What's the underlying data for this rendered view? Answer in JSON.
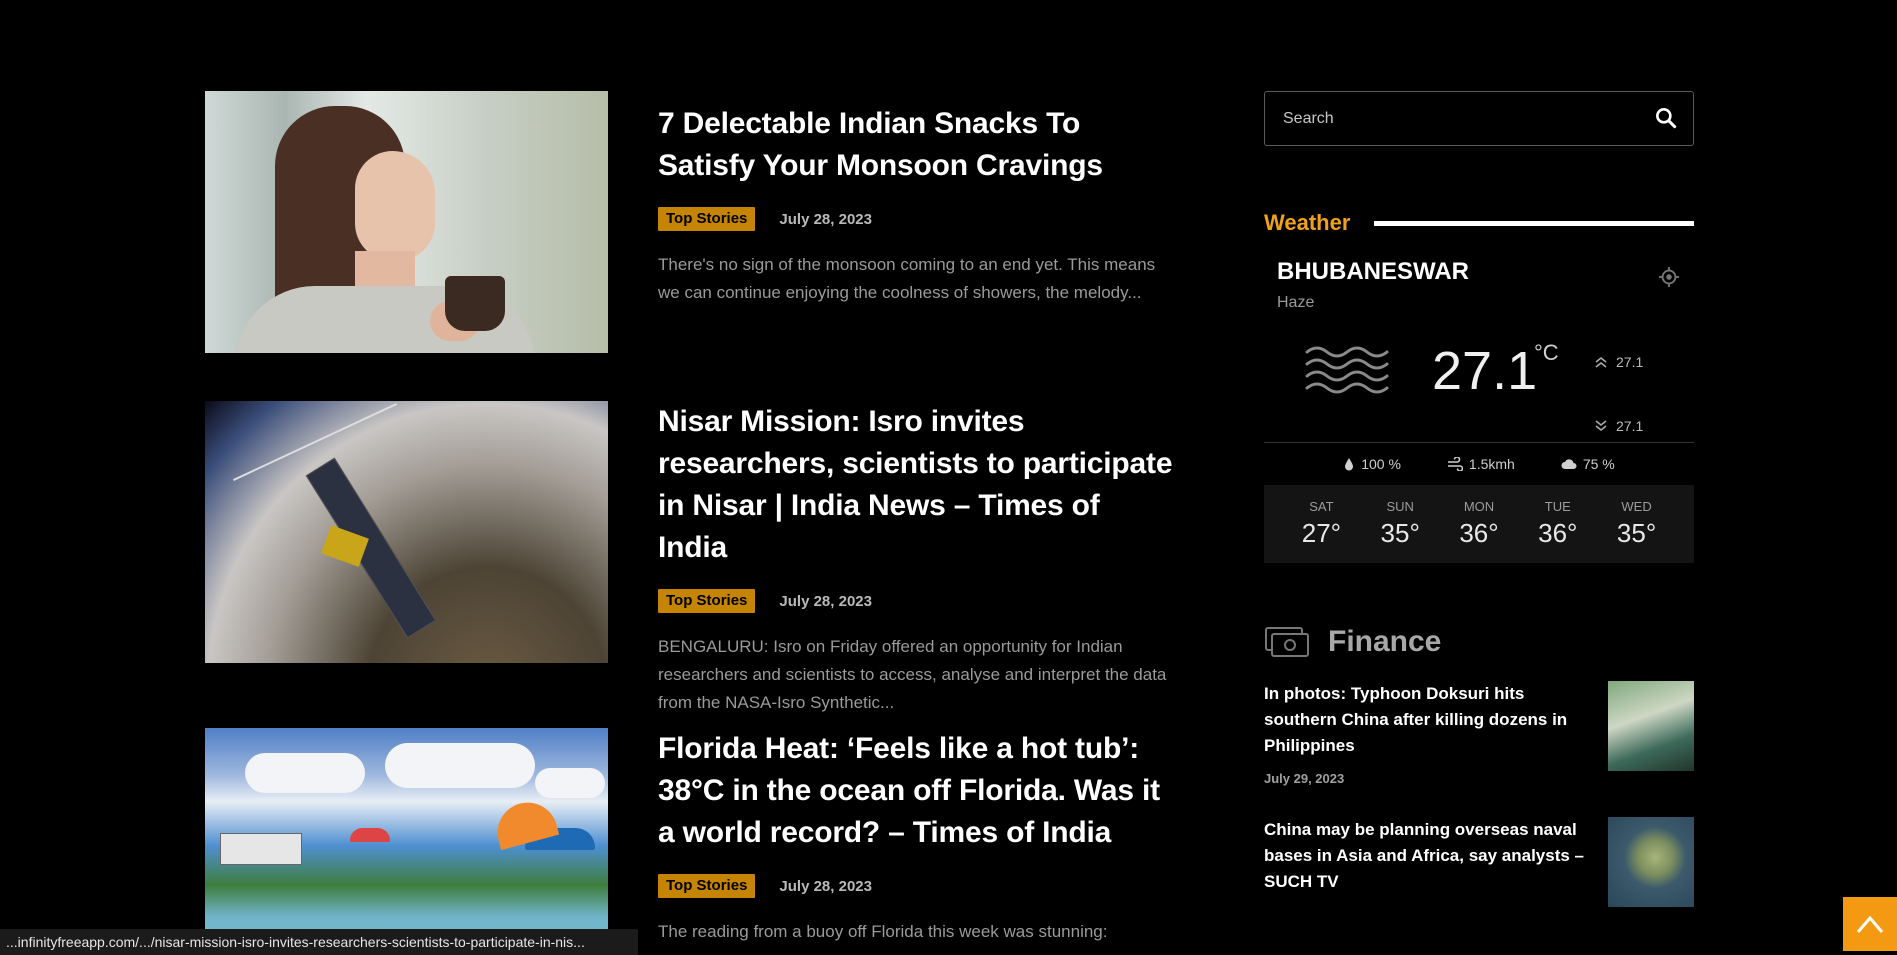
{
  "articles": [
    {
      "title": "7 Delectable Indian Snacks To Satisfy Your Monsoon Cravings",
      "category": "Top Stories",
      "date": "July 28, 2023",
      "excerpt": "There's no sign of the monsoon coming to an end yet. This means we can continue enjoying the coolness of showers, the melody..."
    },
    {
      "title": "Nisar Mission: Isro invites researchers, scientists to participate in Nisar | India News – Times of India",
      "category": "Top Stories",
      "date": "July 28, 2023",
      "excerpt": "BENGALURU: Isro on Friday offered an opportunity for Indian researchers and scientists to access, analyse and interpret the data from the NASA-Isro Synthetic..."
    },
    {
      "title": "Florida Heat: ‘Feels like a hot tub’: 38°C in the ocean off Florida. Was it a world record? – Times of India",
      "category": "Top Stories",
      "date": "July 28, 2023",
      "excerpt": "The reading from a buoy off Florida this week was stunning:"
    }
  ],
  "search": {
    "placeholder": "Search"
  },
  "weather": {
    "heading": "Weather",
    "city": "BHUBANESWAR",
    "condition": "Haze",
    "temp": "27.1",
    "unit": "°C",
    "high": "27.1",
    "low": "27.1",
    "humidity": "100 %",
    "wind": "1.5kmh",
    "clouds": "75 %",
    "forecast": [
      {
        "day": "SAT",
        "temp": "27°"
      },
      {
        "day": "SUN",
        "temp": "35°"
      },
      {
        "day": "MON",
        "temp": "36°"
      },
      {
        "day": "TUE",
        "temp": "36°"
      },
      {
        "day": "WED",
        "temp": "35°"
      }
    ]
  },
  "finance": {
    "heading": "Finance",
    "items": [
      {
        "headline": "In photos: Typhoon Doksuri hits southern China after killing dozens in Philippines",
        "date": "July 29, 2023"
      },
      {
        "headline": "China may be planning overseas naval bases in Asia and Africa, say analysts – SUCH TV",
        "date": ""
      }
    ]
  },
  "statusbar": {
    "url": "...infinityfreeapp.com/.../nisar-mission-isro-invites-researchers-scientists-to-participate-in-nis..."
  },
  "colors": {
    "accent": "#f1a21c",
    "badge": "#c58402",
    "back_to_top": "#f39a12"
  },
  "icons": {
    "search": "search-icon",
    "location": "location-target-icon",
    "haze": "haze-icon",
    "high": "chevron-up-double-icon",
    "low": "chevron-down-double-icon",
    "humidity": "droplet-icon",
    "wind": "wind-icon",
    "clouds": "cloud-icon",
    "finance": "money-icon",
    "back_to_top": "arrow-up-icon"
  }
}
